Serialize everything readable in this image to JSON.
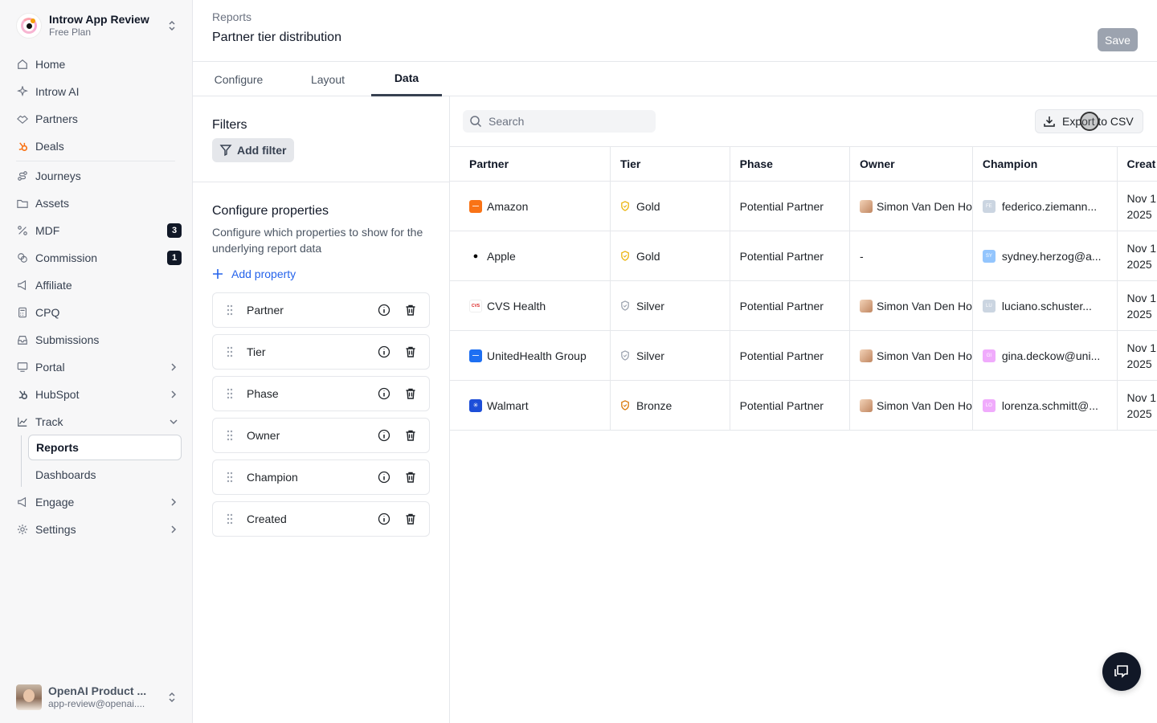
{
  "workspace": {
    "name": "Introw App Review",
    "plan": "Free Plan"
  },
  "nav": {
    "items": [
      {
        "label": "Home",
        "icon": "home-icon"
      },
      {
        "label": "Introw AI",
        "icon": "sparkle-icon"
      },
      {
        "label": "Partners",
        "icon": "handshake-icon"
      },
      {
        "label": "Deals",
        "icon": "hubspot-icon"
      },
      {
        "label": "Journeys",
        "icon": "route-icon"
      },
      {
        "label": "Assets",
        "icon": "folder-icon"
      },
      {
        "label": "MDF",
        "icon": "percent-icon",
        "badge": "3"
      },
      {
        "label": "Commission",
        "icon": "coins-icon",
        "badge": "1"
      },
      {
        "label": "Affiliate",
        "icon": "megaphone-icon"
      },
      {
        "label": "CPQ",
        "icon": "calculator-icon"
      },
      {
        "label": "Submissions",
        "icon": "inbox-icon"
      },
      {
        "label": "Portal",
        "icon": "monitor-icon"
      },
      {
        "label": "HubSpot",
        "icon": "hubspot-icon"
      },
      {
        "label": "Track",
        "icon": "chart-line-icon"
      },
      {
        "label": "Engage",
        "icon": "megaphone-icon"
      },
      {
        "label": "Settings",
        "icon": "gear-icon"
      }
    ],
    "track_sub": [
      "Reports",
      "Dashboards"
    ]
  },
  "user": {
    "name": "OpenAI Product ...",
    "email": "app-review@openai...."
  },
  "header": {
    "breadcrumb": "Reports",
    "title": "Partner tier distribution",
    "save_label": "Save"
  },
  "tabs": [
    "Configure",
    "Layout",
    "Data"
  ],
  "filters": {
    "title": "Filters",
    "add_label": "Add filter"
  },
  "config": {
    "title": "Configure properties",
    "description": "Configure which properties to show for the underlying report data",
    "add_label": "Add property",
    "properties": [
      "Partner",
      "Tier",
      "Phase",
      "Owner",
      "Champion",
      "Created"
    ]
  },
  "data_view": {
    "search_placeholder": "Search",
    "export_label": "Export to CSV",
    "columns": [
      "Partner",
      "Tier",
      "Phase",
      "Owner",
      "Champion",
      "Creat"
    ],
    "rows": [
      {
        "partner": "Amazon",
        "tier": "Gold",
        "phase": "Potential Partner",
        "owner": "Simon Van Den Ho",
        "champion": "federico.ziemann...",
        "champion_initials": "FE",
        "created_1": "Nov 1",
        "created_2": "2025"
      },
      {
        "partner": "Apple",
        "tier": "Gold",
        "phase": "Potential Partner",
        "owner": "-",
        "champion": "sydney.herzog@a...",
        "champion_initials": "SY",
        "created_1": "Nov 1",
        "created_2": "2025"
      },
      {
        "partner": "CVS Health",
        "tier": "Silver",
        "phase": "Potential Partner",
        "owner": "Simon Van Den Ho",
        "champion": "luciano.schuster...",
        "champion_initials": "LU",
        "created_1": "Nov 1",
        "created_2": "2025"
      },
      {
        "partner": "UnitedHealth Group",
        "tier": "Silver",
        "phase": "Potential Partner",
        "owner": "Simon Van Den Ho",
        "champion": "gina.deckow@uni...",
        "champion_initials": "GI",
        "created_1": "Nov 1",
        "created_2": "2025"
      },
      {
        "partner": "Walmart",
        "tier": "Bronze",
        "phase": "Potential Partner",
        "owner": "Simon Van Den Ho",
        "champion": "lorenza.schmitt@...",
        "champion_initials": "LO",
        "created_1": "Nov 1",
        "created_2": "2025"
      }
    ]
  },
  "colors": {
    "accent": "#2563eb",
    "gold": "#eab308",
    "silver": "#9ca3af",
    "bronze": "#d97706"
  }
}
